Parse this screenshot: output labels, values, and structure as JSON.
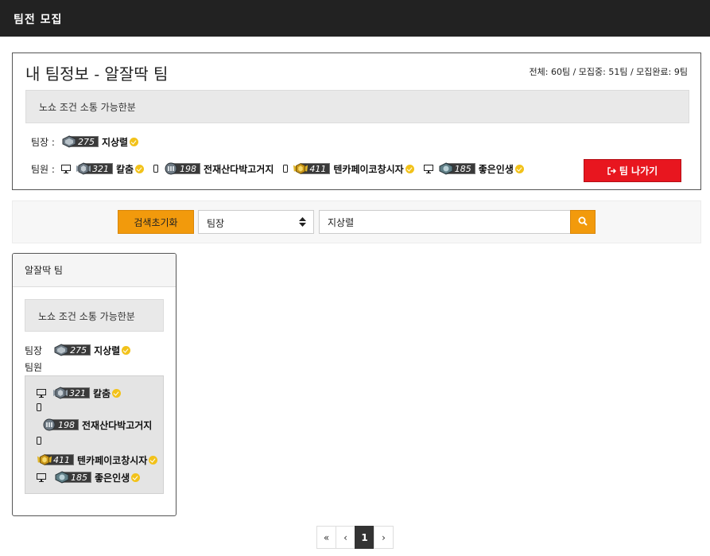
{
  "header": {
    "title": "팀전 모집"
  },
  "my_team": {
    "heading": "내 팀정보 - 알잘딱 팀",
    "stats": "전체: 60팀 / 모집중: 51팀 / 모집완료: 9팀",
    "description": "노쇼 조건 소통 가능한분",
    "leader_label": "팀장 :",
    "members_label": "팀원 :",
    "leader": {
      "level": "275",
      "name": "지상렬"
    },
    "members": [
      {
        "device": "monitor-icon",
        "level": "321",
        "name": "칼춤"
      },
      {
        "device": "phone-icon",
        "level": "198",
        "name": "전재산다박고거지"
      },
      {
        "device": "phone-icon",
        "level": "411",
        "name": "텐카페이코창시자"
      },
      {
        "device": "monitor-icon",
        "level": "185",
        "name": "좋은인생"
      }
    ],
    "leave_label": "팀 나가기"
  },
  "search": {
    "reset_label": "검색초기화",
    "select_value": "팀장",
    "input_value": "지상렬"
  },
  "card": {
    "title": "알잘딱 팀",
    "description": "노쇼 조건 소통 가능한분",
    "leader_label": "팀장",
    "members_label": "팀원",
    "leader": {
      "level": "275",
      "name": "지상렬"
    },
    "members": [
      {
        "level": "321",
        "name": "칼춤"
      },
      {
        "level": "198",
        "name": "전재산다박고거지"
      },
      {
        "level": "411",
        "name": "텐카페이코창시자"
      },
      {
        "level": "185",
        "name": "좋은인생"
      }
    ]
  },
  "pagination": {
    "first": "«",
    "prev": "‹",
    "current": "1",
    "next": "›"
  },
  "colors": {
    "accent": "#f29a0c",
    "danger": "#e8161f",
    "verify": "#f2c21a",
    "topbar": "#222222"
  }
}
